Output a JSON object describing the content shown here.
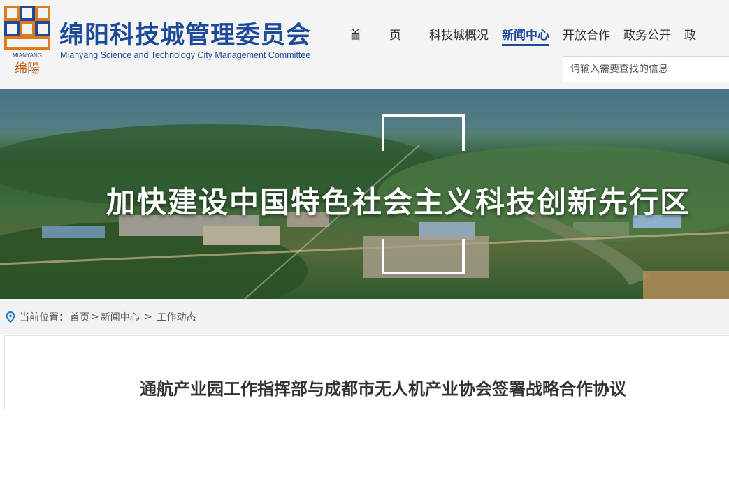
{
  "header": {
    "logo_text": "MIANYANG",
    "logo_calligraphy": "绵陽",
    "title": "绵阳科技城管理委员会",
    "subtitle": "Mianyang Science and Technology City Management Committee"
  },
  "nav": {
    "items": [
      {
        "label": "首页",
        "active": false
      },
      {
        "label": "科技城概况",
        "active": false
      },
      {
        "label": "新闻中心",
        "active": true
      },
      {
        "label": "开放合作",
        "active": false
      },
      {
        "label": "政务公开",
        "active": false
      },
      {
        "label": "政",
        "active": false
      }
    ]
  },
  "search": {
    "placeholder": "请输入需要查找的信息"
  },
  "banner": {
    "slogan": "加快建设中国特色社会主义科技创新先行区"
  },
  "breadcrumb": {
    "prefix": "当前位置：",
    "home": "首页",
    "sep1": ">",
    "section": "新闻中心",
    "sep2": " > ",
    "current": "工作动态"
  },
  "article": {
    "title": "通航产业园工作指挥部与成都市无人机产业协会签署战略合作协议"
  },
  "colors": {
    "brand": "#1e4a9a",
    "logo_orange": "#e07b1c",
    "logo_blue": "#1e4a9a"
  }
}
